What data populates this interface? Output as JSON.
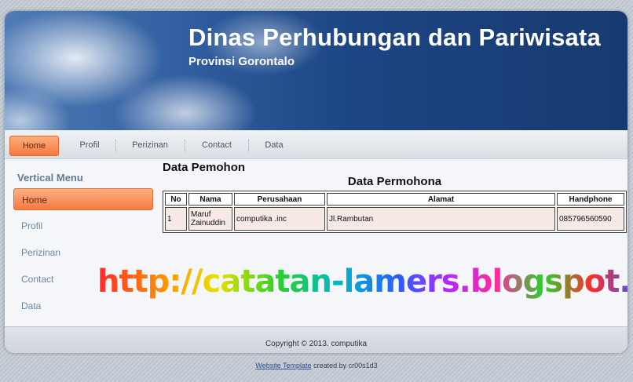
{
  "header": {
    "title": "Dinas Perhubungan dan Pariwisata",
    "subtitle": "Provinsi Gorontalo"
  },
  "nav": {
    "items": [
      {
        "label": "Home",
        "active": true
      },
      {
        "label": "Profil"
      },
      {
        "label": "Perizinan"
      },
      {
        "label": "Contact"
      },
      {
        "label": "Data"
      }
    ]
  },
  "sidebar": {
    "title": "Vertical Menu",
    "items": [
      {
        "label": "Home",
        "active": true
      },
      {
        "label": "Profil"
      },
      {
        "label": "Perizinan"
      },
      {
        "label": "Contact"
      },
      {
        "label": "Data"
      }
    ]
  },
  "content": {
    "title": "Data Pemohon",
    "table_caption": "Data Permohona",
    "columns": [
      "No",
      "Nama",
      "Perusahaan",
      "Alamat",
      "Handphone"
    ],
    "rows": [
      [
        "1",
        "Maruf Zainuddin",
        "computika .inc",
        "Jl.Rambutan",
        "085796560590"
      ]
    ]
  },
  "watermark": "http://catatan-lamers.blogspot.com",
  "footer": {
    "copyright": "Copyright © 2013. computika",
    "credit_link": "Website Template",
    "credit_text": " created by cr00s1d3"
  },
  "colors": {
    "accent": "#f47a3f",
    "banner": "#1d4684"
  }
}
